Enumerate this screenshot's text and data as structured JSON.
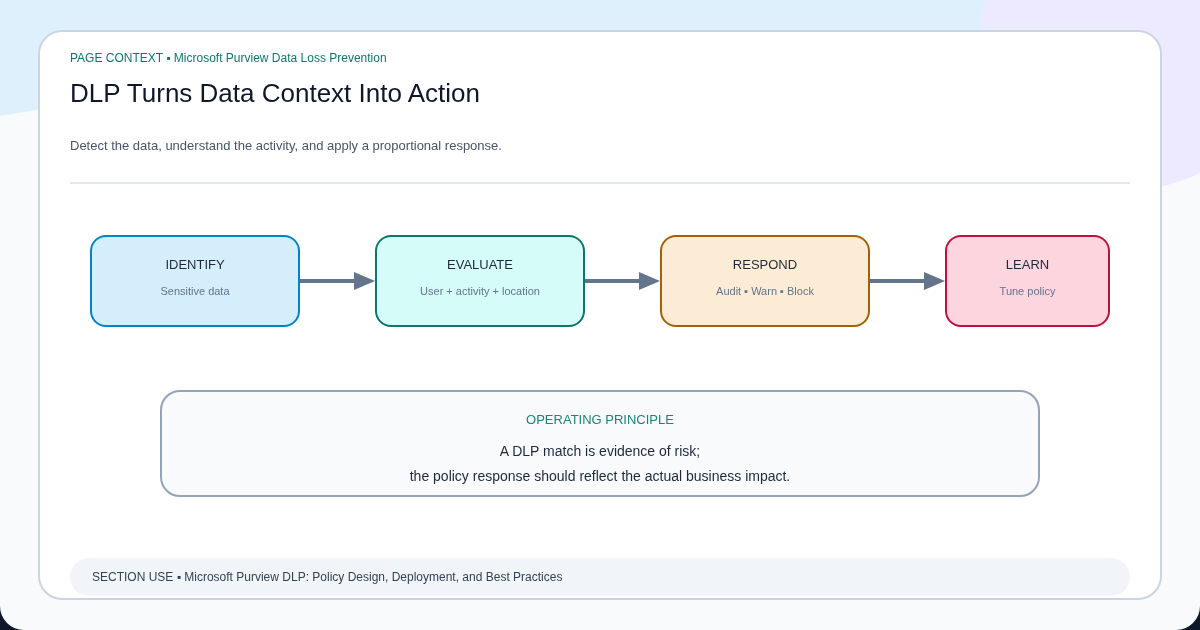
{
  "header": {
    "context": "PAGE CONTEXT ▪ Microsoft Purview Data Loss Prevention",
    "title": "DLP Turns Data Context Into Action",
    "subtitle": "Detect the data, understand the activity, and apply a proportional response."
  },
  "flow": {
    "steps": [
      {
        "title": "IDENTIFY",
        "detail": "Sensitive data",
        "color": "#0284c7"
      },
      {
        "title": "EVALUATE",
        "detail": "User + activity + location",
        "color": "#0f766e"
      },
      {
        "title": "RESPOND",
        "detail": "Audit ▪ Warn ▪ Block",
        "color": "#a16207"
      },
      {
        "title": "LEARN",
        "detail": "Tune policy",
        "color": "#be123c"
      }
    ]
  },
  "principle": {
    "label": "OPERATING PRINCIPLE",
    "text": "A DLP match is evidence of risk;\nthe policy response should reflect the actual business impact."
  },
  "footer": {
    "text": "SECTION USE ▪ Microsoft Purview DLP: Policy Design, Deployment, and Best Practices"
  }
}
